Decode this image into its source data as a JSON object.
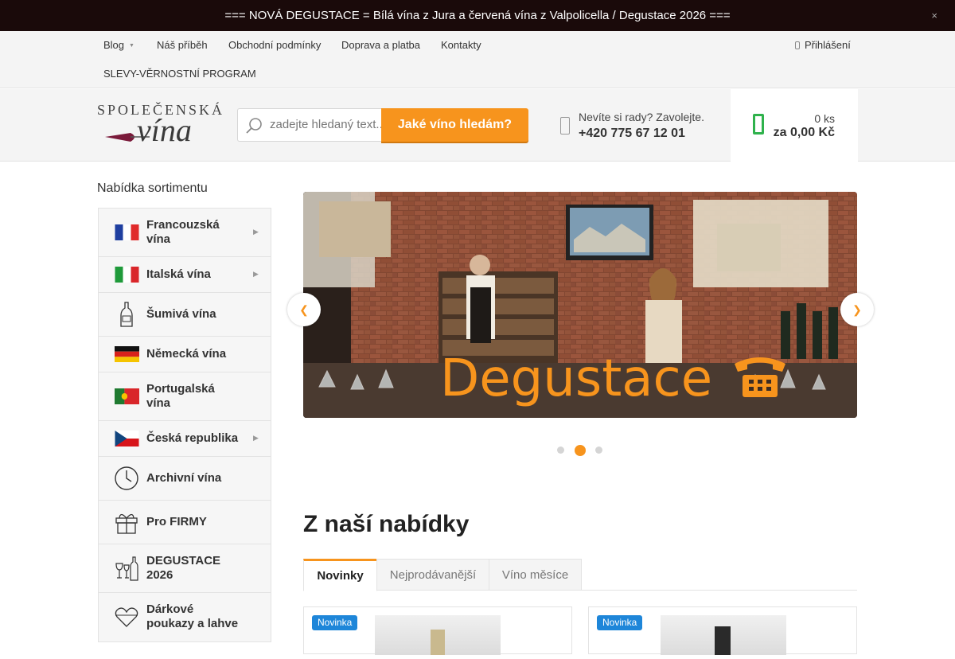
{
  "announcement": {
    "text": "=== NOVÁ DEGUSTACE = Bílá vína z Jura a červená vína z Valpolicella / Degustace 2026 ===",
    "close": "×"
  },
  "topnav": {
    "items": [
      {
        "label": "Blog",
        "has_dropdown": true
      },
      {
        "label": "Náš příběh"
      },
      {
        "label": "Obchodní podmínky"
      },
      {
        "label": "Doprava a platba"
      },
      {
        "label": "Kontakty"
      },
      {
        "label": "SLEVY-VĚRNOSTNÍ PROGRAM"
      }
    ],
    "login": "Přihlášení"
  },
  "logo": {
    "top": "SPOLEČENSKÁ",
    "script": "vína"
  },
  "search": {
    "placeholder": "zadejte hledaný text...",
    "button": "Jaké víno hledám?"
  },
  "contact": {
    "question": "Nevíte si rady? Zavolejte.",
    "phone": "+420 775 67 12 01"
  },
  "cart": {
    "count": "0 ks",
    "total": "za 0,00 Kč"
  },
  "sidebar": {
    "title": "Nabídka sortimentu",
    "items": [
      {
        "label_lines": [
          "Francouzská",
          "vína"
        ],
        "icon": "france-flag-icon",
        "submenu": true
      },
      {
        "label_lines": [
          "Italská vína"
        ],
        "icon": "italy-flag-icon",
        "submenu": true
      },
      {
        "label_lines": [
          "Šumivá vína"
        ],
        "icon": "champagne-bottle-icon",
        "submenu": false
      },
      {
        "label_lines": [
          "Německá vína"
        ],
        "icon": "germany-flag-icon",
        "submenu": false
      },
      {
        "label_lines": [
          "Portugalská",
          "vína"
        ],
        "icon": "portugal-flag-icon",
        "submenu": false
      },
      {
        "label_lines": [
          "Česká republika"
        ],
        "icon": "czech-flag-icon",
        "submenu": true
      },
      {
        "label_lines": [
          "Archivní vína"
        ],
        "icon": "clock-icon",
        "submenu": false
      },
      {
        "label_lines": [
          "Pro FIRMY"
        ],
        "icon": "gift-icon",
        "submenu": false
      },
      {
        "label_lines": [
          "DEGUSTACE",
          "2026"
        ],
        "icon": "tasting-glasses-icon",
        "submenu": false
      },
      {
        "label_lines": [
          "Dárkové",
          "poukazy a lahve"
        ],
        "icon": "heart-ribbon-icon",
        "submenu": false
      }
    ]
  },
  "slider": {
    "caption": "Degustace",
    "active_slide": 2,
    "slide_count": 3
  },
  "offer": {
    "title": "Z naší nabídky",
    "tabs": [
      "Novinky",
      "Nejprodávanější",
      "Víno měsíce"
    ],
    "active_tab": 0,
    "products": [
      {
        "badge": "Novinka"
      },
      {
        "badge": "Novinka"
      }
    ]
  },
  "colors": {
    "accent": "#f7941d",
    "dark_bar": "#1a0a0a",
    "cart_green": "#2fb24c",
    "badge_blue": "#1e86d9"
  }
}
